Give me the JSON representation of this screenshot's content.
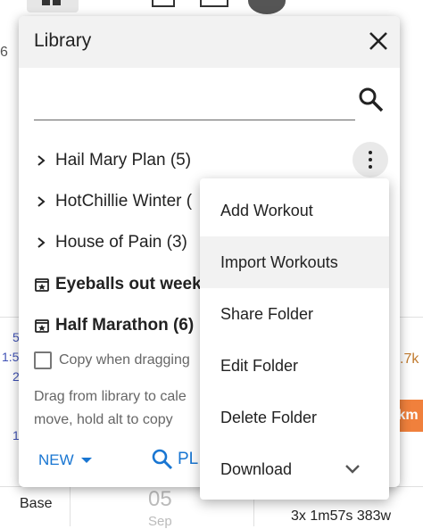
{
  "background": {
    "left_fragments": [
      "6",
      "5",
      "1:5",
      "2",
      "1"
    ],
    "right_fragments": [
      ".7k"
    ],
    "orange_badge": "km",
    "bottom_left_label": "Base",
    "date_number": "05",
    "date_month": "Sep",
    "workout_summary": "3x 1m57s 383w"
  },
  "library": {
    "title": "Library",
    "close_icon": "close-icon",
    "search": {
      "value": "",
      "placeholder": ""
    },
    "items": [
      {
        "label": "Hail Mary Plan (5)",
        "icon": "chevron-right-icon"
      },
      {
        "label": "HotChillie Winter (",
        "icon": "chevron-right-icon"
      },
      {
        "label": "House of Pain (3)",
        "icon": "chevron-right-icon"
      },
      {
        "label": "Eyeballs out week",
        "icon": "calendar-star-icon"
      },
      {
        "label": "Half Marathon (6)",
        "icon": "calendar-star-icon"
      }
    ],
    "copy_when_dragging": "Copy when dragging",
    "hint_line1": "Drag from library to cale",
    "hint_line2": "move, hold alt to copy",
    "new_label": "NEW",
    "plan_label": "PL"
  },
  "menu": {
    "items": [
      "Add Workout",
      "Import Workouts",
      "Share Folder",
      "Edit Folder",
      "Delete Folder",
      "Download"
    ],
    "highlighted_index": 1
  },
  "colors": {
    "accent": "#1976d2",
    "orange": "#f0803c",
    "header_bg": "#f2f2f2"
  }
}
